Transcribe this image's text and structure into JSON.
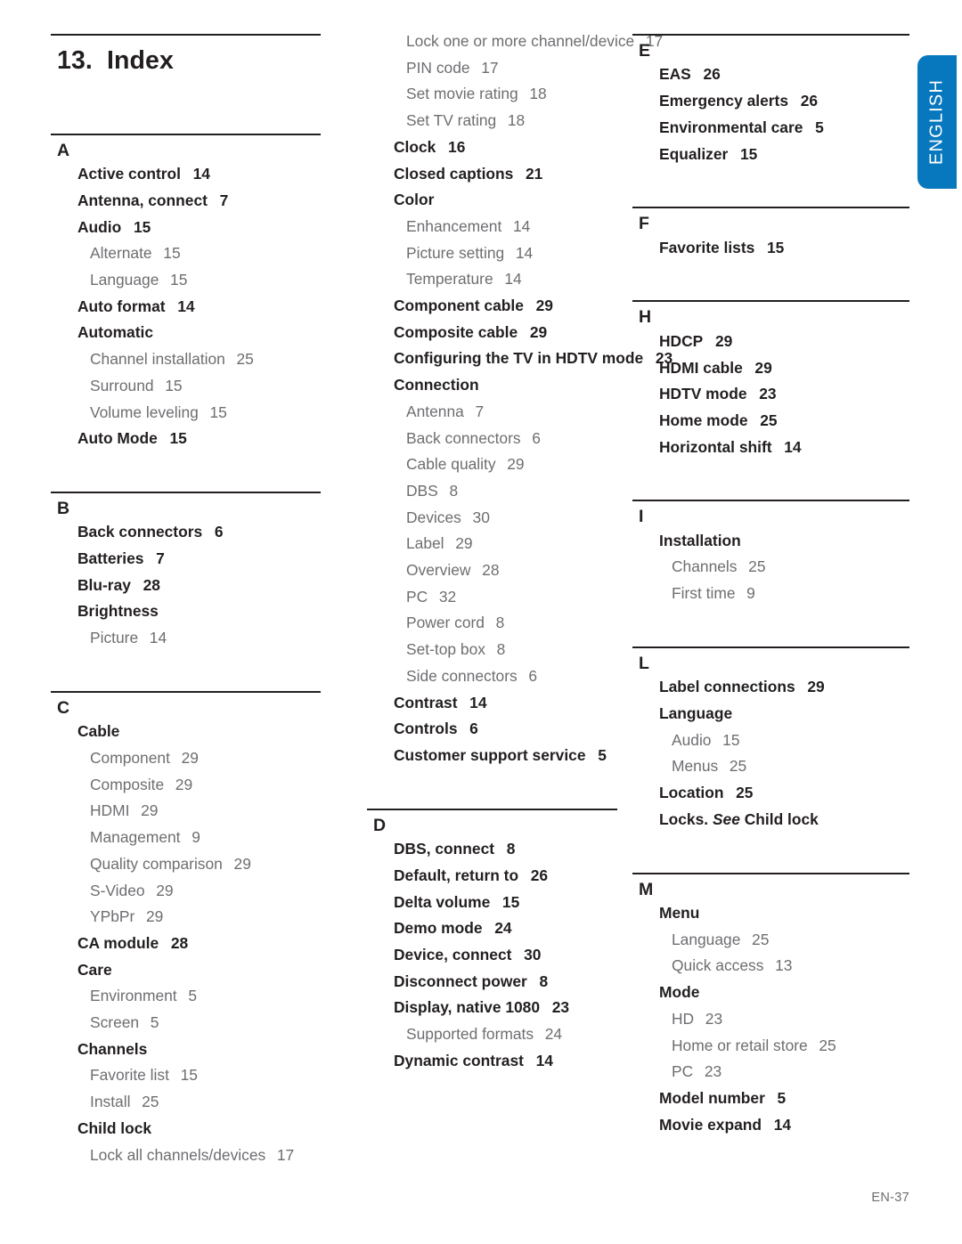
{
  "page": {
    "title_number": "13.",
    "title_text": "Index",
    "footer": "EN-37",
    "language_tab": "ENGLISH",
    "accent_color": "#0878be",
    "text_color": "#231f20",
    "subentry_color": "#6e6e72"
  },
  "columns": [
    {
      "id": "column-1",
      "has_title": true,
      "sections": [
        {
          "letter": "A",
          "entries": [
            {
              "level": 1,
              "label": "Active control",
              "page": "14"
            },
            {
              "level": 1,
              "label": "Antenna, connect",
              "page": "7"
            },
            {
              "level": 1,
              "label": "Audio",
              "page": "15"
            },
            {
              "level": 2,
              "label": "Alternate",
              "page": "15"
            },
            {
              "level": 2,
              "label": "Language",
              "page": "15"
            },
            {
              "level": 1,
              "label": "Auto format",
              "page": "14"
            },
            {
              "level": 1,
              "label": "Automatic",
              "page": ""
            },
            {
              "level": 2,
              "label": "Channel installation",
              "page": "25"
            },
            {
              "level": 2,
              "label": "Surround",
              "page": "15"
            },
            {
              "level": 2,
              "label": "Volume leveling",
              "page": "15"
            },
            {
              "level": 1,
              "label": "Auto Mode",
              "page": "15"
            }
          ]
        },
        {
          "letter": "B",
          "entries": [
            {
              "level": 1,
              "label": "Back connectors",
              "page": "6"
            },
            {
              "level": 1,
              "label": "Batteries",
              "page": "7"
            },
            {
              "level": 1,
              "label": "Blu-ray",
              "page": "28"
            },
            {
              "level": 1,
              "label": "Brightness",
              "page": ""
            },
            {
              "level": 2,
              "label": "Picture",
              "page": "14"
            }
          ]
        },
        {
          "letter": "C",
          "entries": [
            {
              "level": 1,
              "label": "Cable",
              "page": ""
            },
            {
              "level": 2,
              "label": "Component",
              "page": "29"
            },
            {
              "level": 2,
              "label": "Composite",
              "page": "29"
            },
            {
              "level": 2,
              "label": "HDMI",
              "page": "29"
            },
            {
              "level": 2,
              "label": "Management",
              "page": "9"
            },
            {
              "level": 2,
              "label": "Quality comparison",
              "page": "29"
            },
            {
              "level": 2,
              "label": "S-Video",
              "page": "29"
            },
            {
              "level": 2,
              "label": "YPbPr",
              "page": "29"
            },
            {
              "level": 1,
              "label": "CA module",
              "page": "28"
            },
            {
              "level": 1,
              "label": "Care",
              "page": ""
            },
            {
              "level": 2,
              "label": "Environment",
              "page": "5"
            },
            {
              "level": 2,
              "label": "Screen",
              "page": "5"
            },
            {
              "level": 1,
              "label": "Channels",
              "page": ""
            },
            {
              "level": 2,
              "label": "Favorite list",
              "page": "15"
            },
            {
              "level": 2,
              "label": "Install",
              "page": "25"
            },
            {
              "level": 1,
              "label": "Child lock",
              "page": ""
            },
            {
              "level": 2,
              "label": "Lock all channels/devices",
              "page": "17"
            }
          ]
        }
      ]
    },
    {
      "id": "column-2",
      "has_title": false,
      "sections": [
        {
          "letter": "",
          "entries": [
            {
              "level": 2,
              "label": "Lock one or more channel/device",
              "page": "17"
            },
            {
              "level": 2,
              "label": "PIN code",
              "page": "17"
            },
            {
              "level": 2,
              "label": "Set movie rating",
              "page": "18"
            },
            {
              "level": 2,
              "label": "Set TV rating",
              "page": "18"
            },
            {
              "level": 1,
              "label": "Clock",
              "page": "16"
            },
            {
              "level": 1,
              "label": "Closed captions",
              "page": "21"
            },
            {
              "level": 1,
              "label": "Color",
              "page": ""
            },
            {
              "level": 2,
              "label": "Enhancement",
              "page": "14"
            },
            {
              "level": 2,
              "label": "Picture setting",
              "page": "14"
            },
            {
              "level": 2,
              "label": "Temperature",
              "page": "14"
            },
            {
              "level": 1,
              "label": "Component cable",
              "page": "29"
            },
            {
              "level": 1,
              "label": "Composite cable",
              "page": "29"
            },
            {
              "level": 1,
              "label": "Configuring the TV in HDTV mode",
              "page": "23"
            },
            {
              "level": 1,
              "label": "Connection",
              "page": ""
            },
            {
              "level": 2,
              "label": "Antenna",
              "page": "7"
            },
            {
              "level": 2,
              "label": "Back connectors",
              "page": "6"
            },
            {
              "level": 2,
              "label": "Cable quality",
              "page": "29"
            },
            {
              "level": 2,
              "label": "DBS",
              "page": "8"
            },
            {
              "level": 2,
              "label": "Devices",
              "page": "30"
            },
            {
              "level": 2,
              "label": "Label",
              "page": "29"
            },
            {
              "level": 2,
              "label": "Overview",
              "page": "28"
            },
            {
              "level": 2,
              "label": "PC",
              "page": "32"
            },
            {
              "level": 2,
              "label": "Power cord",
              "page": "8"
            },
            {
              "level": 2,
              "label": "Set-top box",
              "page": "8"
            },
            {
              "level": 2,
              "label": "Side connectors",
              "page": "6"
            },
            {
              "level": 1,
              "label": "Contrast",
              "page": "14"
            },
            {
              "level": 1,
              "label": "Controls",
              "page": "6"
            },
            {
              "level": 1,
              "label": "Customer support service",
              "page": "5"
            }
          ]
        },
        {
          "letter": "D",
          "entries": [
            {
              "level": 1,
              "label": "DBS, connect",
              "page": "8"
            },
            {
              "level": 1,
              "label": "Default, return to",
              "page": "26"
            },
            {
              "level": 1,
              "label": "Delta volume",
              "page": "15"
            },
            {
              "level": 1,
              "label": "Demo mode",
              "page": "24"
            },
            {
              "level": 1,
              "label": "Device, connect",
              "page": "30"
            },
            {
              "level": 1,
              "label": "Disconnect power",
              "page": "8"
            },
            {
              "level": 1,
              "label": "Display, native 1080",
              "page": "23"
            },
            {
              "level": 2,
              "label": "Supported formats",
              "page": "24"
            },
            {
              "level": 1,
              "label": "Dynamic contrast",
              "page": "14"
            }
          ]
        }
      ]
    },
    {
      "id": "column-3",
      "has_title": false,
      "sections": [
        {
          "letter": "E",
          "entries": [
            {
              "level": 1,
              "label": "EAS",
              "page": "26"
            },
            {
              "level": 1,
              "label": "Emergency alerts",
              "page": "26"
            },
            {
              "level": 1,
              "label": "Environmental care",
              "page": "5"
            },
            {
              "level": 1,
              "label": "Equalizer",
              "page": "15"
            }
          ]
        },
        {
          "letter": "F",
          "entries": [
            {
              "level": 1,
              "label": "Favorite lists",
              "page": "15"
            }
          ]
        },
        {
          "letter": "H",
          "entries": [
            {
              "level": 1,
              "label": "HDCP",
              "page": "29"
            },
            {
              "level": 1,
              "label": "HDMI cable",
              "page": "29"
            },
            {
              "level": 1,
              "label": "HDTV mode",
              "page": "23"
            },
            {
              "level": 1,
              "label": "Home mode",
              "page": "25"
            },
            {
              "level": 1,
              "label": "Horizontal shift",
              "page": "14"
            }
          ]
        },
        {
          "letter": "I",
          "entries": [
            {
              "level": 1,
              "label": "Installation",
              "page": ""
            },
            {
              "level": 2,
              "label": "Channels",
              "page": "25"
            },
            {
              "level": 2,
              "label": "First time",
              "page": "9"
            }
          ]
        },
        {
          "letter": "L",
          "entries": [
            {
              "level": 1,
              "label": "Label connections",
              "page": "29"
            },
            {
              "level": 1,
              "label": "Language",
              "page": ""
            },
            {
              "level": 2,
              "label": "Audio",
              "page": "15"
            },
            {
              "level": 2,
              "label": "Menus",
              "page": "25"
            },
            {
              "level": 1,
              "label": "Location",
              "page": "25"
            },
            {
              "level": 1,
              "label": "Locks. ",
              "page": "",
              "italic": "See",
              "after_italic": " Child lock"
            }
          ]
        },
        {
          "letter": "M",
          "entries": [
            {
              "level": 1,
              "label": "Menu",
              "page": ""
            },
            {
              "level": 2,
              "label": "Language",
              "page": "25"
            },
            {
              "level": 2,
              "label": "Quick access",
              "page": "13"
            },
            {
              "level": 1,
              "label": "Mode",
              "page": ""
            },
            {
              "level": 2,
              "label": "HD",
              "page": "23"
            },
            {
              "level": 2,
              "label": "Home or retail store",
              "page": "25"
            },
            {
              "level": 2,
              "label": "PC",
              "page": "23"
            },
            {
              "level": 1,
              "label": "Model number",
              "page": "5"
            },
            {
              "level": 1,
              "label": "Movie expand",
              "page": "14"
            }
          ]
        }
      ]
    }
  ]
}
